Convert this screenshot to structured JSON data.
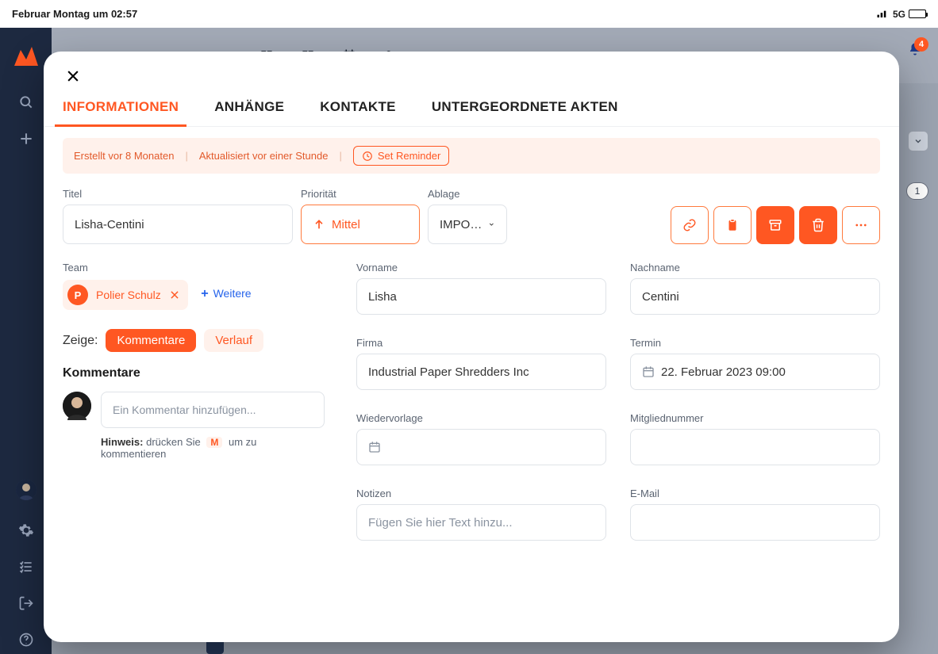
{
  "status_bar": {
    "time": "Februar Montag um 02:57",
    "net": "5G"
  },
  "notifications_count": "4",
  "right_pill": "1",
  "modal": {
    "tabs": {
      "info": "INFORMATIONEN",
      "anh": "ANHÄNGE",
      "kon": "KONTAKTE",
      "unter": "UNTERGEORDNETE AKTEN"
    },
    "meta": {
      "created": "Erstellt vor 8 Monaten",
      "updated": "Aktualisiert vor einer Stunde",
      "reminder": "Set Reminder"
    },
    "labels": {
      "titel": "Titel",
      "prio": "Priorität",
      "ablage": "Ablage",
      "team": "Team",
      "weitere": "Weitere",
      "zeige": "Zeige:",
      "kommentare": "Kommentare",
      "verlauf": "Verlauf",
      "kom_section": "Kommentare",
      "comment_ph": "Ein Kommentar hinzufügen...",
      "hint_pre": "Hinweis:",
      "hint_mid": "drücken Sie",
      "hint_key": "M",
      "hint_post": "um zu kommentieren",
      "vorname": "Vorname",
      "nachname": "Nachname",
      "firma": "Firma",
      "termin": "Termin",
      "wiedervorlage": "Wiedervorlage",
      "mitglied": "Mitgliednummer",
      "notizen": "Notizen",
      "email": "E-Mail",
      "notizen_ph": "Fügen Sie hier Text hinzu..."
    },
    "values": {
      "titel": "Lisha-Centini",
      "prio": "Mittel",
      "ablage": "IMPO…",
      "team_chip": "Polier Schulz",
      "team_initial": "P",
      "vorname": "Lisha",
      "nachname": "Centini",
      "firma": "Industrial Paper Shredders Inc",
      "termin": "22. Februar 2023 09:00",
      "wiedervorlage": "",
      "mitglied": "",
      "email": ""
    }
  }
}
